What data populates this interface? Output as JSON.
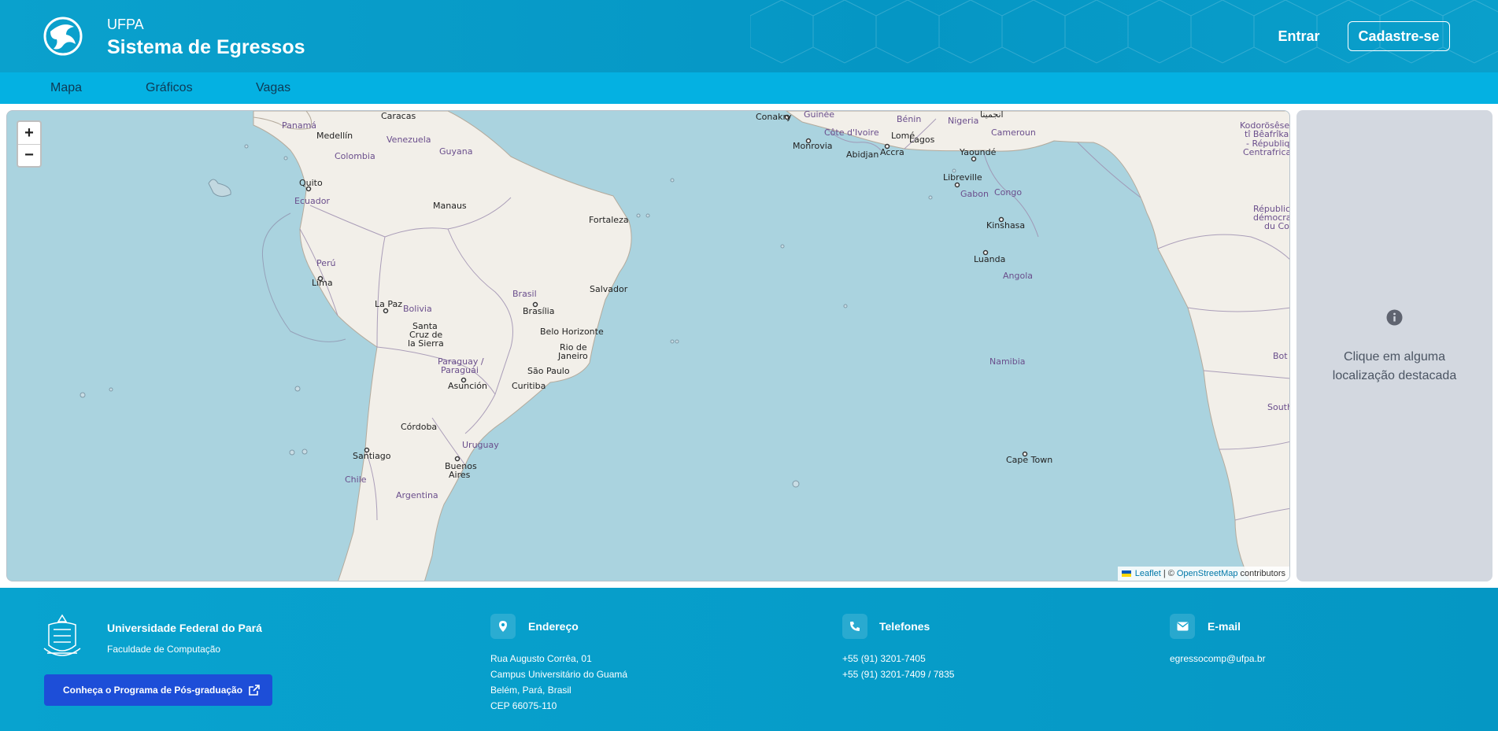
{
  "header": {
    "brand_small": "UFPA",
    "brand_big": "Sistema de Egressos",
    "login_label": "Entrar",
    "signup_label": "Cadastre-se"
  },
  "nav": {
    "items": [
      {
        "label": "Mapa"
      },
      {
        "label": "Gráficos"
      },
      {
        "label": "Vagas"
      }
    ]
  },
  "map": {
    "zoom_in": "+",
    "zoom_out": "−",
    "labels": {
      "countries": {
        "panama": "Panamá",
        "venezuela": "Venezuela",
        "colombia": "Colombia",
        "guyana": "Guyana",
        "ecuador": "Ecuador",
        "peru": "Perú",
        "bolivia": "Bolivia",
        "brasil": "Brasil",
        "paraguay": "Paraguay / Paraguái",
        "uruguay": "Uruguay",
        "chile": "Chile",
        "argentina": "Argentina",
        "guinee": "Guinée",
        "cote_divoire": "Côte d'Ivoire",
        "benin": "Bénin",
        "nigeria": "Nigeria",
        "cameroun": "Cameroun",
        "kodoro": "Kodorösêse tî Bêafrîka - République Centrafricaine",
        "gabon": "Gabon",
        "congo": "Congo",
        "rdc": "République démocratique du Congo",
        "angola": "Angola",
        "namibia": "Namibia",
        "botswana": "Bot",
        "south_africa": "South"
      },
      "cities": {
        "caracas": "Caracas",
        "medellin": "Medellín",
        "quito": "Quito",
        "manaus": "Manaus",
        "fortaleza": "Fortaleza",
        "lima": "Lima",
        "la_paz": "La Paz",
        "salvador": "Salvador",
        "brasilia": "Brasília",
        "santa_cruz": "Santa Cruz de la Sierra",
        "belo_horizonte": "Belo Horizonte",
        "rio": "Rio de Janeiro",
        "sao_paulo": "São Paulo",
        "asuncion": "Asunción",
        "curitiba": "Curitiba",
        "cordoba": "Córdoba",
        "santiago": "Santiago",
        "buenos_aires": "Buenos Aires",
        "conakry": "Conakry",
        "monrovia": "Monrovia",
        "abidjan": "Abidjan",
        "accra": "Accra",
        "lome": "Lomé",
        "lagos": "Lagos",
        "yaounde": "Yaoundé",
        "libreville": "Libreville",
        "kinshasa": "Kinshasa",
        "luanda": "Luanda",
        "cape_town": "Cape Town",
        "ndjamena": "انجمينا"
      }
    },
    "attribution": {
      "leaflet": "Leaflet",
      "separator": "| ©",
      "osm": "OpenStreetMap",
      "contributors": "contributors"
    },
    "colors": {
      "water": "#aad3df",
      "land": "#f2efe9",
      "border": "#9e8fb0",
      "label": "#6a4e8c"
    }
  },
  "side_panel": {
    "message": "Clique em alguma localização destacada"
  },
  "footer": {
    "university": "Universidade Federal do Pará",
    "faculty": "Faculdade de Computação",
    "pos_button": "Conheça o Programa de Pós-graduação",
    "address": {
      "title": "Endereço",
      "lines": [
        "Rua Augusto Corrêa, 01",
        "Campus Universitário do Guamá",
        "Belém, Pará, Brasil",
        "CEP 66075-110"
      ]
    },
    "phones": {
      "title": "Telefones",
      "lines": [
        "+55 (91) 3201-7405",
        "+55 (91) 3201-7409 / 7835"
      ]
    },
    "email": {
      "title": "E-mail",
      "lines": [
        "egressocomp@ufpa.br"
      ]
    }
  }
}
